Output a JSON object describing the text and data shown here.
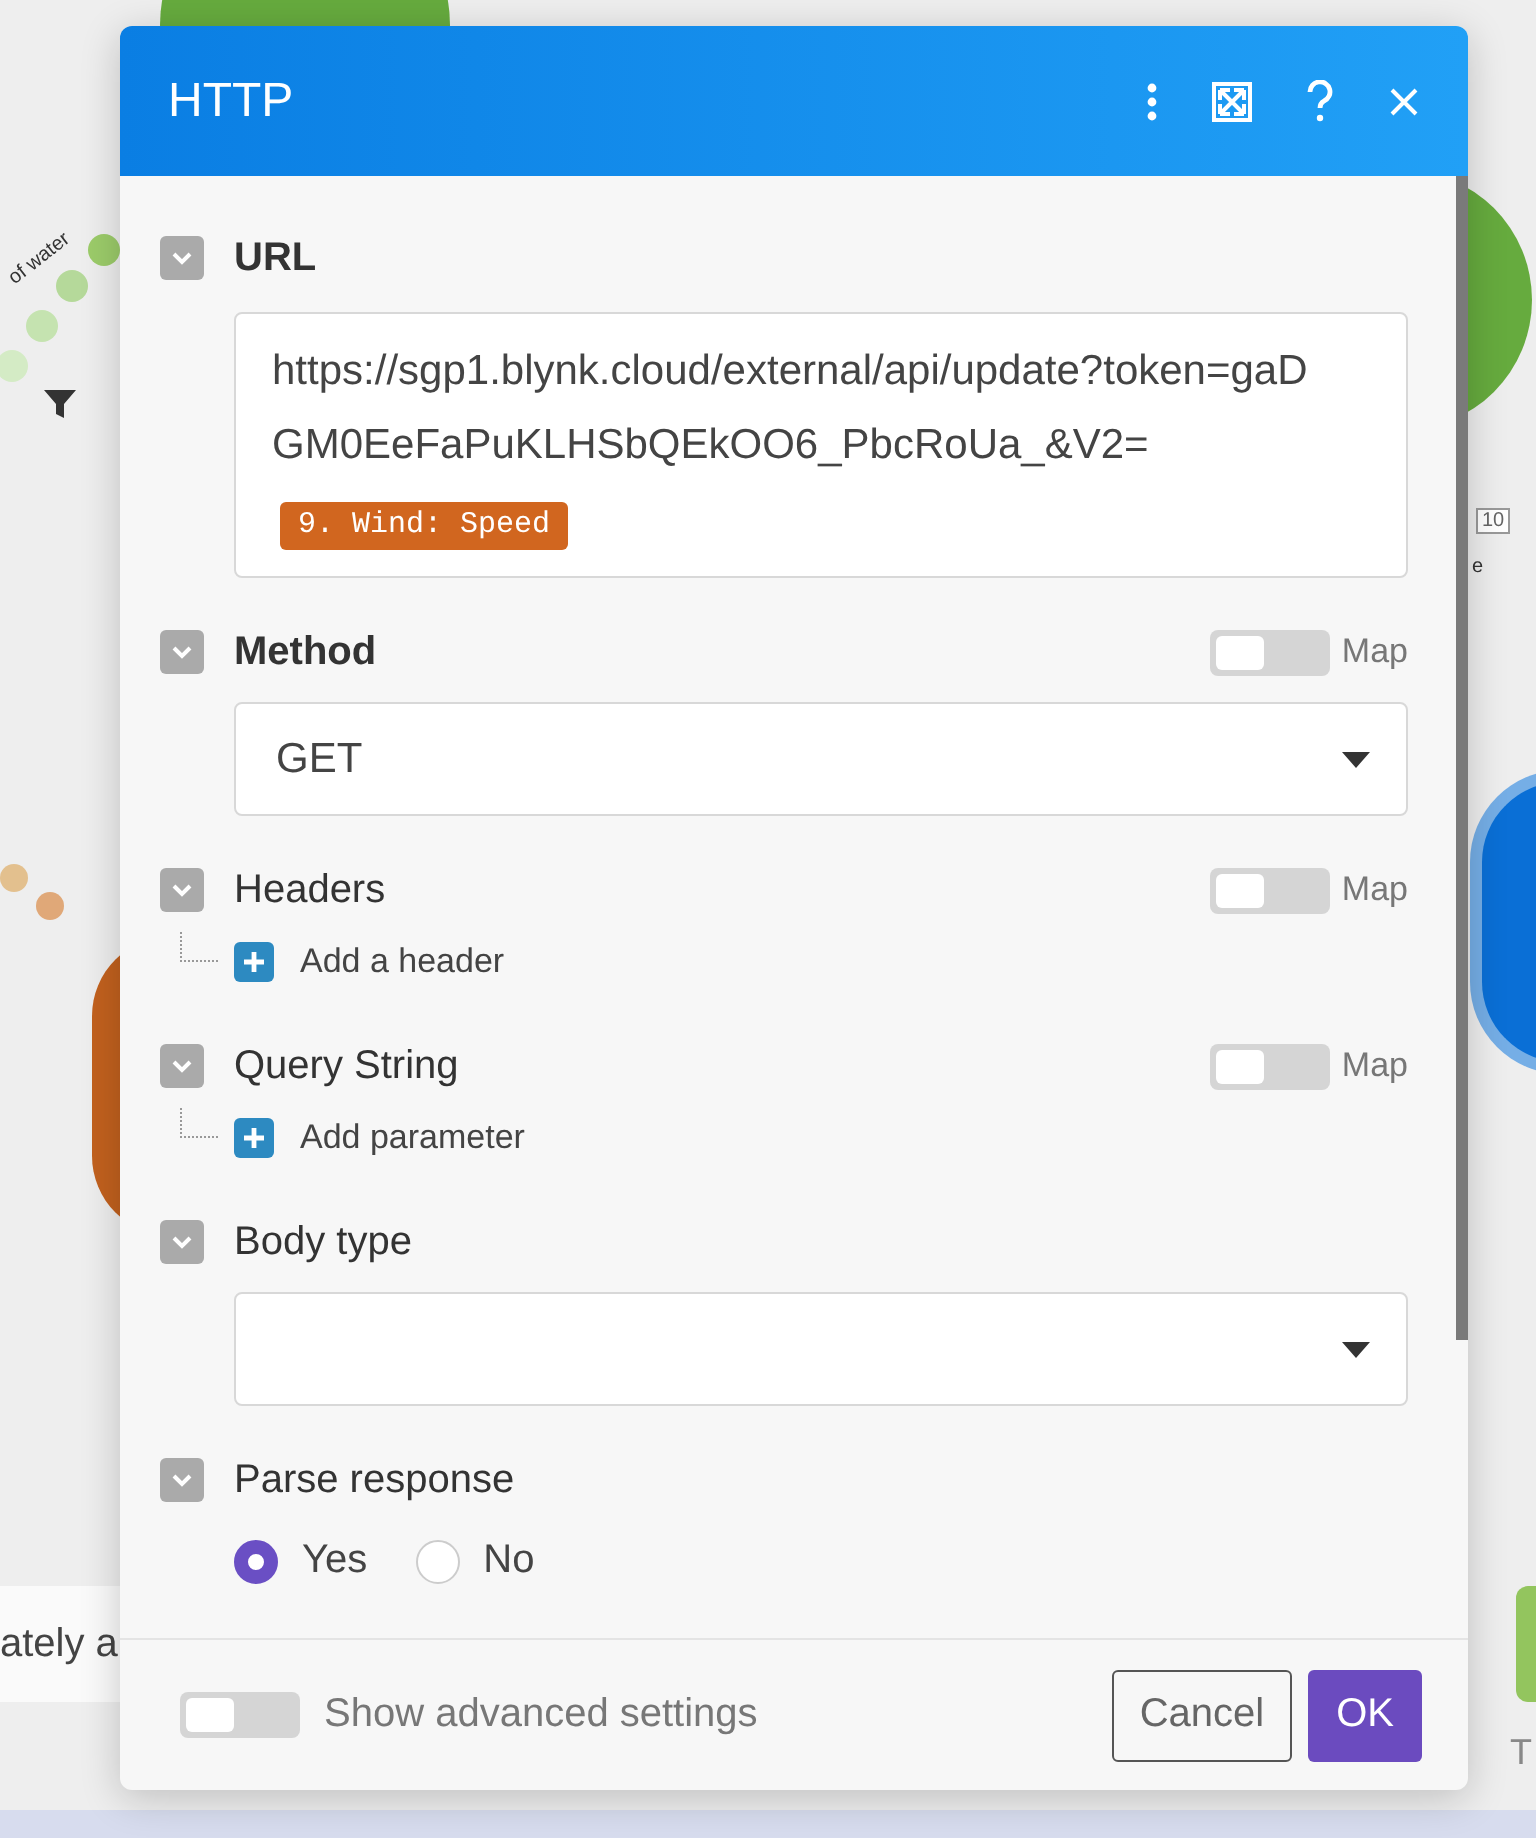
{
  "canvas": {
    "labels": [
      {
        "text": "of water",
        "kind": "rotated"
      },
      {
        "text": "10",
        "kind": "badge"
      },
      {
        "text": "e",
        "kind": "plain"
      },
      {
        "text": "ately a",
        "kind": "note"
      },
      {
        "text": "T",
        "kind": "caption"
      }
    ]
  },
  "dialog": {
    "title": "HTTP",
    "sections": [
      {
        "kind": "url",
        "label": "URL",
        "required": true,
        "text": "https://sgp1.blynk.cloud/external/api/update?token=gaDGM0EeFaPuKLHSbQEkOO6_PbcRoUa_&V2=",
        "pill": "9. Wind: Speed"
      },
      {
        "kind": "select",
        "label": "Method",
        "required": true,
        "map": {
          "label": "Map",
          "on": false
        },
        "value": "GET"
      },
      {
        "kind": "add",
        "label": "Headers",
        "required": false,
        "map": {
          "label": "Map",
          "on": false
        },
        "action": "Add a header"
      },
      {
        "kind": "add",
        "label": "Query String",
        "required": false,
        "map": {
          "label": "Map",
          "on": false
        },
        "action": "Add parameter"
      },
      {
        "kind": "select",
        "label": "Body type",
        "required": false
      },
      {
        "kind": "radio",
        "label": "Parse response",
        "required": false,
        "options": [
          {
            "label": "Yes",
            "selected": true
          },
          {
            "label": "No",
            "selected": false
          }
        ]
      }
    ],
    "advanced": {
      "label": "Show advanced settings",
      "on": false
    },
    "cancel": "Cancel",
    "ok": "OK"
  }
}
